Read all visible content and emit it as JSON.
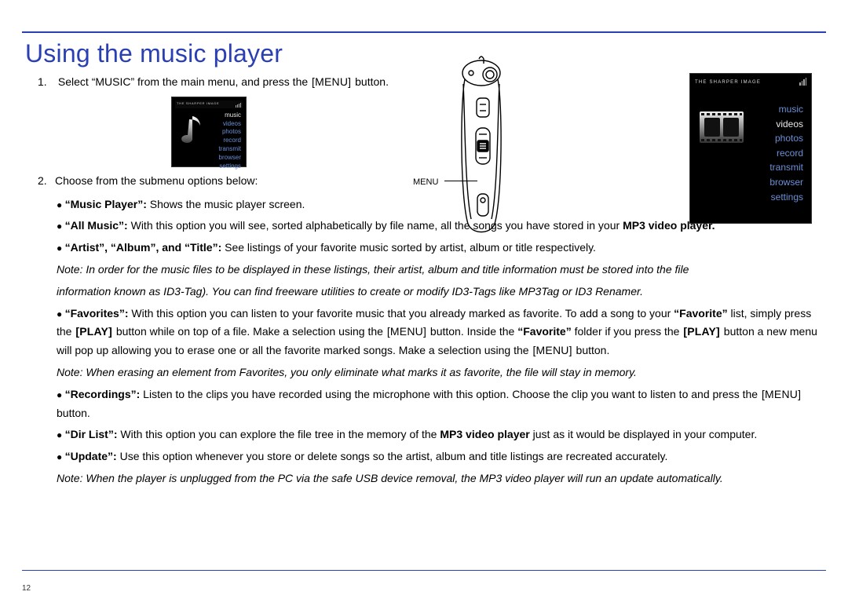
{
  "page_number": "12",
  "title": "Using the music player",
  "step1_pre": "Select “",
  "step1_music": "MUSIC",
  "step1_mid": "” from the main menu, and press the ",
  "step1_btn": "[MENU]",
  "step1_post": " button.",
  "step2": "Choose from the submenu options below:",
  "menu_label": "MENU",
  "brand": "THE SHARPER IMAGE",
  "menu_items": {
    "music": "music",
    "videos": "videos",
    "photos": "photos",
    "record": "record",
    "transmit": "transmit",
    "browser": "browser",
    "settings": "settings"
  },
  "bullets": {
    "mp_label": "“Music Player”: ",
    "mp_text": "Shows the music player screen.",
    "all_label": "“All Music”: ",
    "all_pre": "With this option you will see, sorted alphabetically by file name, all the songs you have stored in your ",
    "all_bold": "MP3 video player.",
    "aat_label": "“Artist”, “Album”, and “Title”: ",
    "aat_text": "See listings of your favorite music sorted by artist, album or title respectively.",
    "aat_note1_pre": "Note: ",
    "aat_note1": "In order for the music files to be displayed in these listings, their artist, album and title information must be stored into the file",
    "aat_note2": "information known as ID3-Tag).  You can find freeware utilities to create or modify ID3-Tags like MP3Tag or ID3 Renamer.",
    "fav_label": "“Favorites”: ",
    "fav_t1": "With this option you can listen to your favorite music that you already marked as favorite.  To add a song to your ",
    "fav_b1": "“Favorite”",
    "fav_t2": " list, simply press the ",
    "fav_btn_play1": "[PLAY]",
    "fav_t3": " button while on top of a file.  Make a selection using the ",
    "fav_btn_menu1": "[MENU]",
    "fav_t4": " button.  Inside the ",
    "fav_b2": "“Favorite”",
    "fav_t5": " folder if you press the ",
    "fav_btn_play2": "[PLAY]",
    "fav_t6": " button a new menu will pop up allowing you to erase one or all the favorite marked songs.  Make a selection using the ",
    "fav_btn_menu2": "[MENU]",
    "fav_t7": " button.",
    "fav_note_pre": "Note: ",
    "fav_note": "When erasing an element from Favorites, you only eliminate what marks it as favorite, the file will stay in memory.",
    "rec_label": "“Recordings”: ",
    "rec_t1": "Listen to the clips you have recorded using the microphone with this option.  Choose the clip you want to listen to and press the ",
    "rec_btn": "[MENU]",
    "rec_t2": " button.",
    "dir_label": "“Dir List”: ",
    "dir_t1": "With this option you can explore the file tree in the memory of the ",
    "dir_bold": "MP3 video player",
    "dir_t2": " just as it would be displayed in your computer.",
    "upd_label": "“Update”: ",
    "upd_text": "Use this option whenever you store or delete songs so the artist, album and title listings are recreated accurately.",
    "upd_note_pre": "Note: ",
    "upd_note1": "When the player is unplugged from the PC via the safe USB device removal, the ",
    "upd_note_mid": "MP3 video player",
    "upd_note2": " will run an update automatically."
  }
}
